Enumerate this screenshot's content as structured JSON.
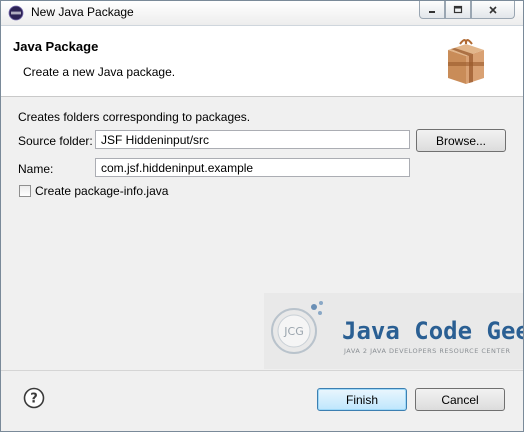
{
  "window": {
    "title": "New Java Package"
  },
  "header": {
    "title": "Java Package",
    "description": "Create a new Java package."
  },
  "form": {
    "info": "Creates folders corresponding to packages.",
    "source_folder_label": "Source folder:",
    "source_folder_value": "JSF Hiddeninput/src",
    "browse_label": "Browse...",
    "name_label": "Name:",
    "name_value": "com.jsf.hiddeninput.example",
    "create_package_info_label": "Create package-info.java",
    "create_package_info_checked": false
  },
  "watermark": {
    "logo_text": "JCG",
    "brand": "Java Code Geeks",
    "tagline": "JAVA 2 JAVA DEVELOPERS RESOURCE CENTER"
  },
  "footer": {
    "finish_label": "Finish",
    "cancel_label": "Cancel"
  },
  "icons": {
    "app": "eclipse-icon",
    "header": "package-icon",
    "help": "help-icon",
    "minimize": "minimize-icon",
    "maximize": "maximize-icon",
    "close": "close-icon"
  },
  "colors": {
    "default_button_border": "#3c7fb1",
    "watermark_blue": "#2a5f93"
  }
}
